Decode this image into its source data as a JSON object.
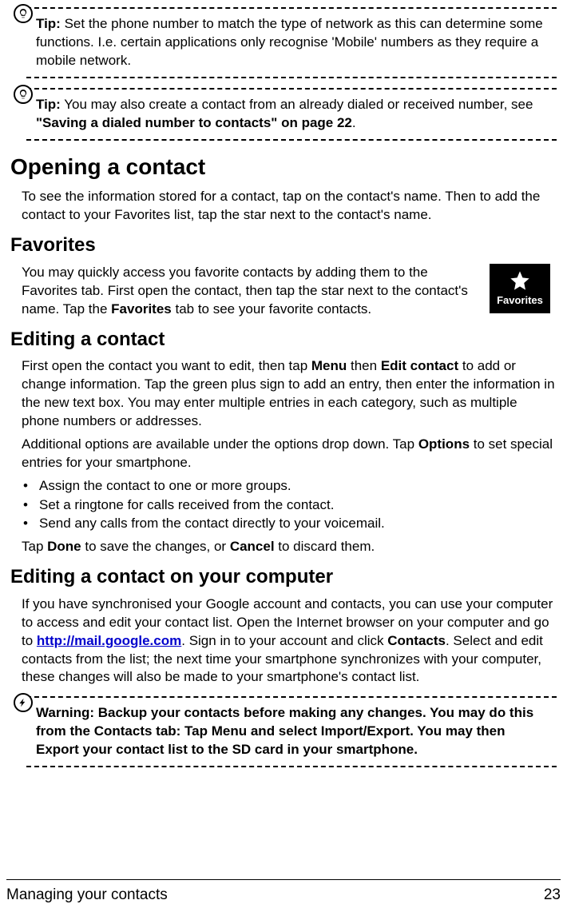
{
  "tip1": {
    "label": "Tip:",
    "text": " Set the phone number to match the type of network as this can determine some functions. I.e. certain applications only recognise 'Mobile' numbers as they require a mobile network."
  },
  "tip2": {
    "label": "Tip:",
    "text": " You may also create a contact from an already dialed or received number, see ",
    "xref": "\"Saving a dialed number to contacts\" on page 22",
    "end": "."
  },
  "opening": {
    "heading": "Opening a contact",
    "body": "To see the information stored for a contact, tap on the contact's name. Then to add the contact to your Favorites list, tap the star next to the contact's name."
  },
  "favorites": {
    "heading": "Favorites",
    "body_pre": "You may quickly access you favorite contacts by adding them to the Favorites tab. First open the contact, then tap the star next to the contact's name. Tap the ",
    "body_bold": "Favorites",
    "body_post": " tab to see your favorite contacts.",
    "badge": "Favorites"
  },
  "editing": {
    "heading": "Editing a contact",
    "p1_pre": "First open the contact you want to edit, then tap ",
    "p1_b1": "Menu",
    "p1_mid": " then ",
    "p1_b2": "Edit contact",
    "p1_post": " to add or change information. Tap the green plus sign to add an entry, then enter the information in the new text box. You may enter multiple entries in each category, such as multiple phone numbers or addresses.",
    "p2_pre": "Additional options are available under the options drop down. Tap ",
    "p2_b": "Options",
    "p2_post": " to set special entries for your smartphone.",
    "bullets": [
      "Assign the contact to one or more groups.",
      "Set a ringtone for calls received from the contact.",
      "Send any calls from the contact directly to your voicemail."
    ],
    "p3_pre": "Tap ",
    "p3_b1": "Done",
    "p3_mid": " to save the changes, or ",
    "p3_b2": "Cancel",
    "p3_post": " to discard them."
  },
  "editing_computer": {
    "heading": "Editing a contact on your computer",
    "p_pre": "If you have synchronised your Google account and contacts, you can use your computer to access and edit your contact list. Open the Internet browser on your computer and go to ",
    "link": "http://mail.google.com",
    "p_mid": ". Sign in to your account and click ",
    "p_b": "Contacts",
    "p_post": ". Select and edit contacts from the list; the next time your smartphone synchronizes with your computer, these changes will also be made to your smartphone's contact list."
  },
  "warning": {
    "text": "Warning: Backup your contacts before making any changes. You may do this from the Contacts tab: Tap Menu and select Import/Export. You may then Export your contact list to the SD card in your smartphone."
  },
  "footer": {
    "section": "Managing your contacts",
    "page": "23"
  }
}
